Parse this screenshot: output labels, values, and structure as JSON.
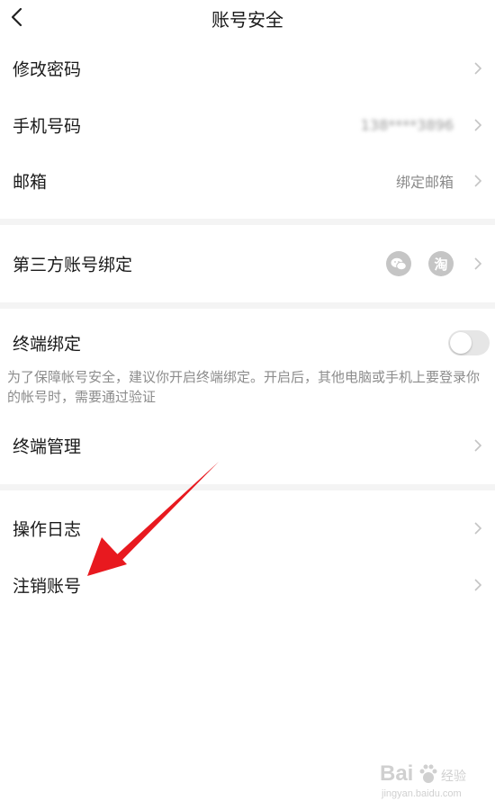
{
  "header": {
    "title": "账号安全"
  },
  "section1": [
    {
      "label": "修改密码",
      "value": ""
    },
    {
      "label": "手机号码",
      "value": "138****3896"
    },
    {
      "label": "邮箱",
      "value": "绑定邮箱"
    }
  ],
  "section2": {
    "label": "第三方账号绑定",
    "icons": [
      "wechat-icon",
      "taobao-icon"
    ],
    "taobao_glyph": "淘"
  },
  "section3": {
    "label": "终端绑定",
    "toggle_on": false,
    "description": "为了保障帐号安全，建议你开启终端绑定。开启后，其他电脑或手机上要登录你的帐号时，需要通过验证",
    "manage_label": "终端管理"
  },
  "section4": [
    {
      "label": "操作日志"
    },
    {
      "label": "注销账号"
    }
  ],
  "annotation": {
    "color": "#e8191f"
  },
  "watermark": {
    "brand": "Bai",
    "text": "经验",
    "url": "jingyan.baidu.com"
  }
}
